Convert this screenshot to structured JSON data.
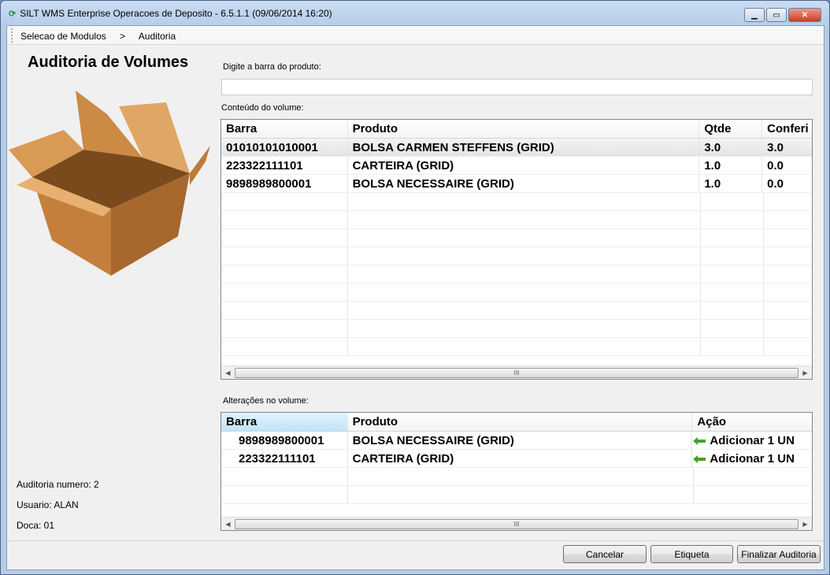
{
  "window": {
    "title": "SILT WMS Enterprise Operacoes de Deposito - 6.5.1.1 (09/06/2014 16:20)"
  },
  "breadcrumb": {
    "items": [
      "Selecao de Modulos",
      ">",
      "Auditoria"
    ]
  },
  "page": {
    "title": "Auditoria de Volumes"
  },
  "barcode": {
    "label": "Digite a barra do produto:",
    "value": ""
  },
  "contents": {
    "label": "Conteúdo do volume:",
    "columns": [
      "Barra",
      "Produto",
      "Qtde",
      "Conferi"
    ],
    "rows": [
      [
        "01010101010001",
        "BOLSA CARMEN STEFFENS (GRID)",
        "3.0",
        "3.0"
      ],
      [
        "223322111101",
        "CARTEIRA (GRID)",
        "1.0",
        "0.0"
      ],
      [
        "9898989800001",
        "BOLSA NECESSAIRE (GRID)",
        "1.0",
        "0.0"
      ]
    ]
  },
  "changes": {
    "label": "Alterações no volume:",
    "columns": [
      "Barra",
      "Produto",
      "Ação"
    ],
    "rows": [
      [
        "9898989800001",
        "BOLSA NECESSAIRE (GRID)",
        "Adicionar 1 UN"
      ],
      [
        "223322111101",
        "CARTEIRA (GRID)",
        "Adicionar 1 UN"
      ]
    ]
  },
  "info": {
    "auditoria": "Auditoria numero: 2",
    "usuario": "Usuario: ALAN",
    "doca": "Doca: 01"
  },
  "buttons": {
    "cancel": "Cancelar",
    "label": "Etiqueta",
    "finish": "Finalizar Auditoria"
  },
  "scroll_thumb": "III"
}
